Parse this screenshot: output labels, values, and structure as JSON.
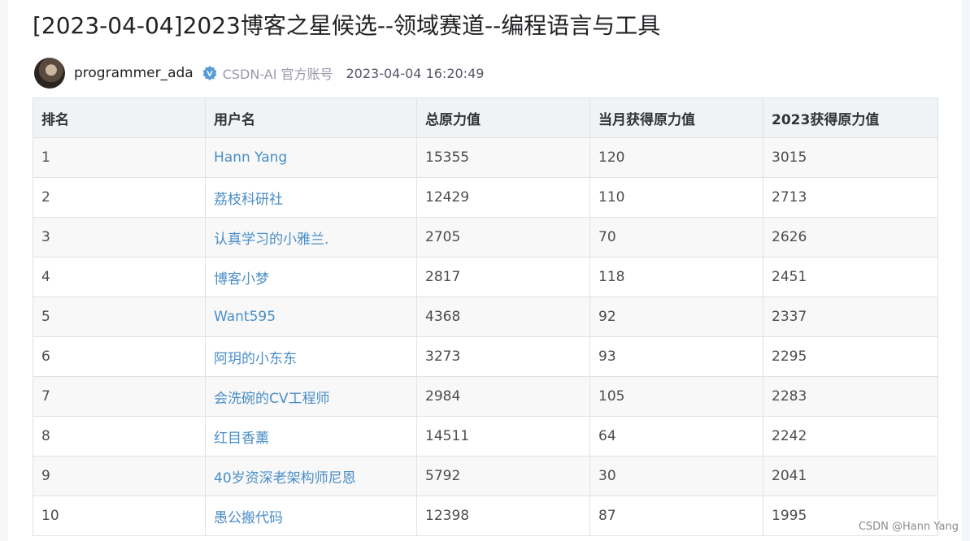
{
  "article": {
    "title": "[2023-04-04]2023博客之星候选--领域赛道--编程语言与工具",
    "author": "programmer_ada",
    "org": "CSDN-AI 官方账号",
    "time": "2023-04-04 16:20:49",
    "verify_icon": "verified-badge-icon"
  },
  "table": {
    "headers": [
      "排名",
      "用户名",
      "总原力值",
      "当月获得原力值",
      "2023获得原力值"
    ],
    "rows": [
      [
        "1",
        "Hann Yang",
        "15355",
        "120",
        "3015"
      ],
      [
        "2",
        "荔枝科研社",
        "12429",
        "110",
        "2713"
      ],
      [
        "3",
        "认真学习的小雅兰.",
        "2705",
        "70",
        "2626"
      ],
      [
        "4",
        "博客小梦",
        "2817",
        "118",
        "2451"
      ],
      [
        "5",
        "Want595",
        "4368",
        "92",
        "2337"
      ],
      [
        "6",
        "阿玥的小东东",
        "3273",
        "93",
        "2295"
      ],
      [
        "7",
        "会洗碗的CV工程师",
        "2984",
        "105",
        "2283"
      ],
      [
        "8",
        "红目香薰",
        "14511",
        "64",
        "2242"
      ],
      [
        "9",
        "40岁资深老架构师尼恩",
        "5792",
        "30",
        "2041"
      ],
      [
        "10",
        "愚公搬代码",
        "12398",
        "87",
        "1995"
      ]
    ]
  },
  "watermark": "CSDN @Hann Yang",
  "colors": {
    "link": "#4a8ec7",
    "header_bg": "#eff3f5",
    "verify": "#5b9bd5"
  }
}
